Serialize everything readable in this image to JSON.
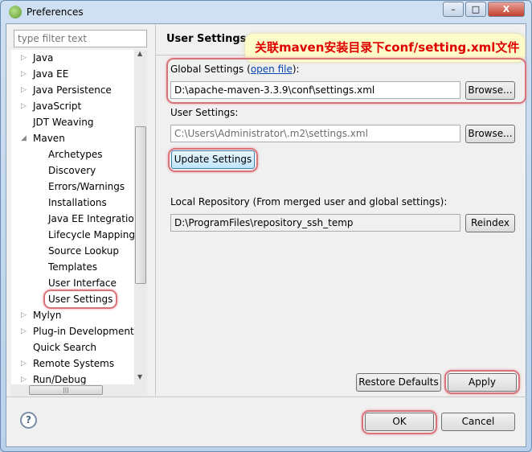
{
  "window": {
    "title": "Preferences",
    "minimize": "–",
    "maximize": "□",
    "close": "X"
  },
  "filter": {
    "placeholder": "type filter text"
  },
  "tree": [
    {
      "label": "Java",
      "level": 0,
      "arrow": "right"
    },
    {
      "label": "Java EE",
      "level": 0,
      "arrow": "right"
    },
    {
      "label": "Java Persistence",
      "level": 0,
      "arrow": "right"
    },
    {
      "label": "JavaScript",
      "level": 0,
      "arrow": "right"
    },
    {
      "label": "JDT Weaving",
      "level": 0,
      "arrow": "none"
    },
    {
      "label": "Maven",
      "level": 0,
      "arrow": "down"
    },
    {
      "label": "Archetypes",
      "level": 1
    },
    {
      "label": "Discovery",
      "level": 1
    },
    {
      "label": "Errors/Warnings",
      "level": 1
    },
    {
      "label": "Installations",
      "level": 1
    },
    {
      "label": "Java EE Integration",
      "level": 1
    },
    {
      "label": "Lifecycle Mapping",
      "level": 1
    },
    {
      "label": "Source Lookup",
      "level": 1
    },
    {
      "label": "Templates",
      "level": 1
    },
    {
      "label": "User Interface",
      "level": 1
    },
    {
      "label": "User Settings",
      "level": 1,
      "selected": true
    },
    {
      "label": "Mylyn",
      "level": 0,
      "arrow": "right"
    },
    {
      "label": "Plug-in Development",
      "level": 0,
      "arrow": "right"
    },
    {
      "label": "Quick Search",
      "level": 0,
      "arrow": "none"
    },
    {
      "label": "Remote Systems",
      "level": 0,
      "arrow": "right"
    },
    {
      "label": "Run/Debug",
      "level": 0,
      "arrow": "right"
    }
  ],
  "page": {
    "title": "User Settings",
    "annotation": "关联maven安装目录下conf/setting.xml文件",
    "global_label_prefix": "Global Settings (",
    "global_link": "open file",
    "global_label_suffix": "):",
    "global_value": "D:\\apache-maven-3.3.9\\conf\\settings.xml",
    "user_label": "User Settings:",
    "user_value": "C:\\Users\\Administrator\\.m2\\settings.xml",
    "browse": "Browse...",
    "update": "Update Settings",
    "local_label": "Local Repository (From merged user and global settings):",
    "local_value": "D:\\ProgramFiles\\repository_ssh_temp",
    "reindex": "Reindex",
    "restore": "Restore Defaults",
    "apply": "Apply"
  },
  "footer": {
    "help": "?",
    "ok": "OK",
    "cancel": "Cancel"
  },
  "colors": {
    "highlight": "#d9737a",
    "annotation_text": "#e00000",
    "annotation_bg": "#fdfbc8"
  }
}
